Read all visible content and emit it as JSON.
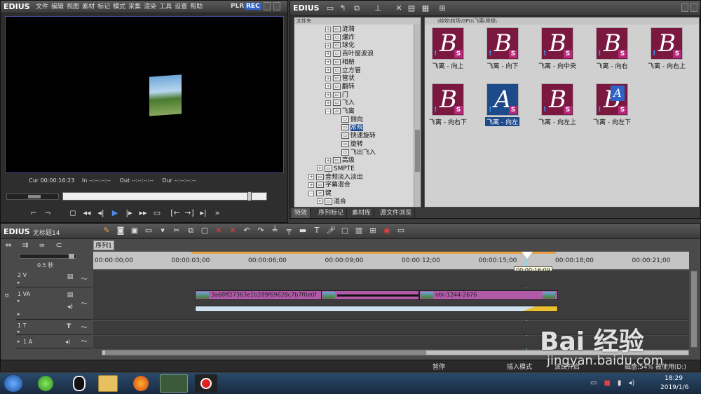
{
  "player": {
    "brand": "EDIUS",
    "menu": [
      "文件",
      "编辑",
      "视图",
      "素材",
      "标记",
      "模式",
      "采集",
      "渲染",
      "工具",
      "设置",
      "帮助"
    ],
    "plr": "PLR",
    "rec": "REC",
    "timecodes": {
      "cur_label": "Cur",
      "cur": "00:00:16:23",
      "in_label": "In",
      "in": "--:--:--:--",
      "out_label": "Out",
      "out": "--:--:--:--",
      "dur_label": "Dur",
      "dur": "--:--:--:--"
    }
  },
  "library": {
    "brand": "EDIUS",
    "folder_header": "文件夹",
    "path": "\\特效\\转场\\GPU\\飞离\\常规\\",
    "tree": [
      {
        "label": "涟漪",
        "type": "box",
        "indent": 0
      },
      {
        "label": "爆炸",
        "type": "box",
        "indent": 0
      },
      {
        "label": "球化",
        "type": "box",
        "indent": 0
      },
      {
        "label": "百叶窗波浪",
        "type": "box",
        "indent": 0
      },
      {
        "label": "相册",
        "type": "box",
        "indent": 0
      },
      {
        "label": "立方管",
        "type": "box",
        "indent": 0
      },
      {
        "label": "管状",
        "type": "box",
        "indent": 0
      },
      {
        "label": "翻转",
        "type": "box",
        "indent": 0
      },
      {
        "label": "门",
        "type": "box",
        "indent": 0
      },
      {
        "label": "飞入",
        "type": "box",
        "indent": 0
      },
      {
        "label": "飞离",
        "type": "open",
        "indent": 0
      },
      {
        "label": "侧向",
        "type": "box",
        "indent": 1
      },
      {
        "label": "常规",
        "type": "box",
        "indent": 1,
        "selected": true
      },
      {
        "label": "快速旋转",
        "type": "box",
        "indent": 1
      },
      {
        "label": "旋转",
        "type": "box",
        "indent": 1
      },
      {
        "label": "飞出飞入",
        "type": "box",
        "indent": 1
      },
      {
        "label": "高级",
        "type": "box",
        "indent": 0
      },
      {
        "label": "SMPTE",
        "type": "box",
        "indent": -1
      },
      {
        "label": "音频淡入淡出",
        "type": "box",
        "indent": -2
      },
      {
        "label": "字幕混合",
        "type": "box",
        "indent": -2
      },
      {
        "label": "键",
        "type": "open",
        "indent": -2
      },
      {
        "label": "混合",
        "type": "box",
        "indent": -1
      }
    ],
    "thumbs": [
      {
        "letter": "B",
        "label": "飞离 - 向上"
      },
      {
        "letter": "B",
        "label": "飞离 - 向下"
      },
      {
        "letter": "B",
        "label": "飞离 - 向中央"
      },
      {
        "letter": "B",
        "label": "飞离 - 向右"
      },
      {
        "letter": "B",
        "label": "飞离 - 向右上"
      },
      {
        "letter": "B",
        "label": "飞离 - 向右下"
      },
      {
        "letter": "A",
        "label": "飞离 - 向左",
        "selected": true
      },
      {
        "letter": "B",
        "label": "飞离 - 向左上"
      },
      {
        "letter": "B",
        "label": "飞离 - 向左下",
        "overlay": "A"
      }
    ],
    "tabs": [
      "特效",
      "序列标记",
      "素材库",
      "源文件浏览"
    ]
  },
  "timeline": {
    "brand": "EDIUS",
    "project": "无标题14",
    "sequence_tab": "序列1",
    "zoom": "0.5 秒",
    "ruler": [
      "00:00:00;00",
      "00:00:03;00",
      "00:00:06;00",
      "00:00:09;00",
      "00:00:12;00",
      "00:00:15;00",
      "00:00:18;00",
      "00:00:21;00"
    ],
    "playhead": "00:00:16:09",
    "tracks": [
      {
        "name": "2 V"
      },
      {
        "name": "1 VA"
      },
      {
        "name": "1 T"
      },
      {
        "name": "1 A"
      }
    ],
    "clips": {
      "clip1": "3a68ff27363e1b289f69628c7b7f0e0f",
      "clip2": "ntk-1244-2676"
    },
    "status": {
      "pause": "暂停",
      "insert": "插入模式",
      "ripple": "波纹开启",
      "disk": "磁盘:54% 被使用(D:)"
    }
  },
  "taskbar": {
    "time": "18:29",
    "date": "2019/1/6"
  },
  "watermark": {
    "text": "Bai 经验",
    "url": "jingyan.baidu.com"
  },
  "colors": {
    "thumb_bg": "#7a1840",
    "thumb_selected": "#1d4a8a",
    "clip": "#b05aa8",
    "rec": "#2f63c8"
  }
}
